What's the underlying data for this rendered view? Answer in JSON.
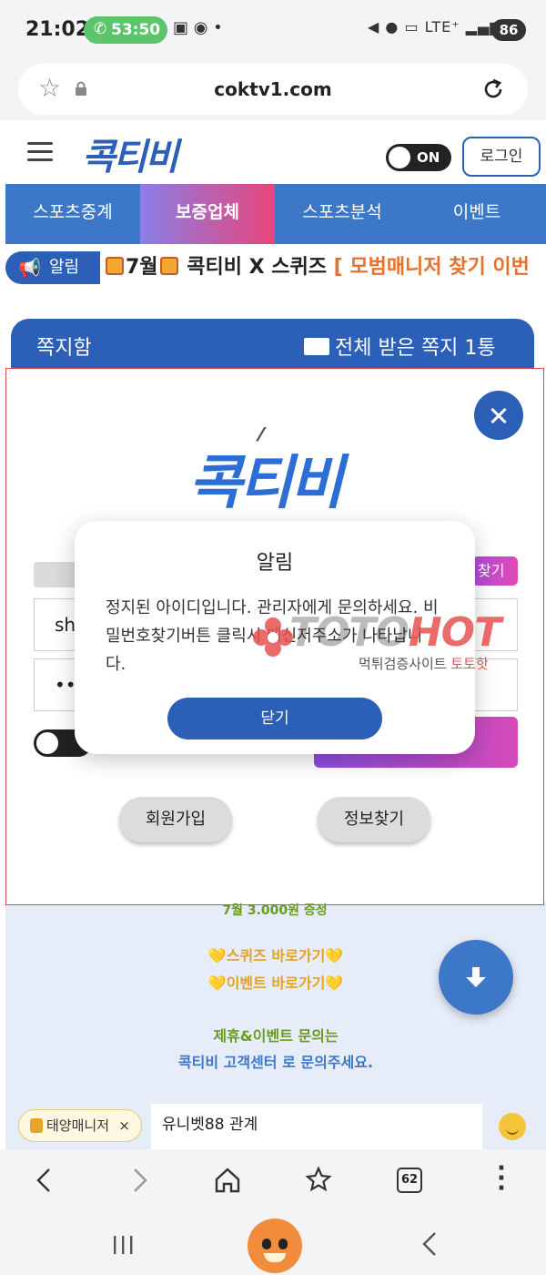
{
  "status_bar": {
    "time": "21:02",
    "call_timer": "53:50",
    "battery": "86",
    "network": "LTE⁺"
  },
  "browser": {
    "url": "coktv1.com"
  },
  "header": {
    "logo": "콕티비",
    "toggle_label": "ON",
    "login_label": "로그인"
  },
  "nav": {
    "items": [
      {
        "label": "스포츠중계"
      },
      {
        "label": "보증업체"
      },
      {
        "label": "스포츠분석"
      },
      {
        "label": "이벤트"
      }
    ]
  },
  "ticker": {
    "badge": "알림",
    "text_part1": "7월",
    "text_part2": "콕티비 X 스퀴즈 ",
    "text_highlight": "[ 모범매니저 찾기 이번"
  },
  "message_bar": {
    "title": "쪽지함",
    "count": "전체 받은 쪽지 1통"
  },
  "login_modal": {
    "logo": "콕티비",
    "find_tag": "찾기",
    "id_value": "sh",
    "pw_value": "•••",
    "signup_label": "회원가입",
    "find_info_label": "정보찾기",
    "peek_text": "7월 3.000원 증정"
  },
  "alert": {
    "title": "알림",
    "message": "정지된 아이디입니다. 관리자에게 문의하세요. 비밀번호찾기버튼 클릭시 메신저주소가 나타납니다.",
    "ok_label": "닫기"
  },
  "watermark": {
    "text_a": "TOTO",
    "text_b": "HOT",
    "sub_a": "먹튀검증사이트 ",
    "sub_b": "토토핫"
  },
  "background_page": {
    "squeeze_link": "💛스퀴즈 바로가기💛",
    "event_link": "💛이벤트 바로가기💛",
    "contact_1": "제휴&이벤트 문의는",
    "contact_2": "콕티비 고객센터 로 문의주세요."
  },
  "chat": {
    "chip_label": "태양매니저",
    "chip_close": "×",
    "input_text": "유니벳88 관계"
  },
  "browser_bottom": {
    "tabs_count": "62"
  },
  "colors": {
    "brand_blue": "#2b5fb8",
    "nav_blue": "#3d77c8",
    "accent_pink": "#e8457a",
    "highlight_orange": "#e8702a"
  }
}
